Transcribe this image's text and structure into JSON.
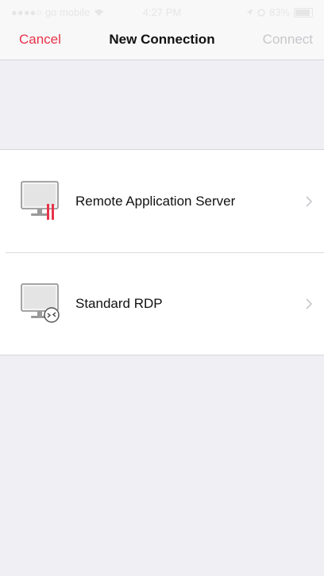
{
  "status_bar": {
    "carrier": "●●●●○ go mobile",
    "time": "4:27 PM",
    "battery": "83%",
    "battery_level": 0.83
  },
  "nav": {
    "cancel_label": "Cancel",
    "title": "New Connection",
    "connect_label": "Connect"
  },
  "connections": [
    {
      "label": "Remote Application Server",
      "icon": "monitor-ras-icon"
    },
    {
      "label": "Standard RDP",
      "icon": "monitor-rdp-icon"
    }
  ],
  "colors": {
    "accent": "#e8334a",
    "disabled": "#c7c7cc",
    "background": "#efeff4"
  }
}
